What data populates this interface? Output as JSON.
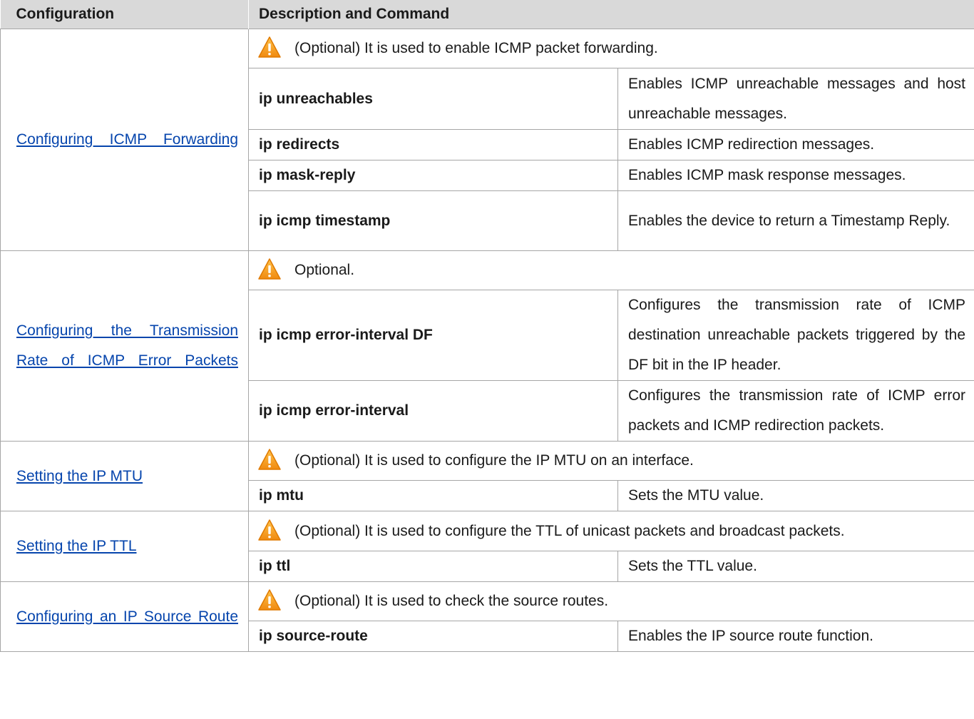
{
  "header": {
    "col1": "Configuration",
    "col2": "Description and Command"
  },
  "sections": [
    {
      "config_link": "Configuring ICMP Forwarding",
      "note": "(Optional) It is used to enable ICMP packet forwarding.",
      "rows": [
        {
          "command": "ip unreachables",
          "description": "Enables ICMP unreachable messages and host unreachable messages."
        },
        {
          "command": "ip redirects",
          "description": "Enables ICMP redirection messages."
        },
        {
          "command": "ip mask-reply",
          "description": "Enables ICMP mask response messages."
        },
        {
          "command": "ip icmp timestamp",
          "description": "Enables the device to return a Timestamp Reply."
        }
      ]
    },
    {
      "config_link": "Configuring the Transmission Rate of ICMP Error Packets",
      "note": "Optional.",
      "rows": [
        {
          "command": "ip icmp error-interval DF",
          "description": "Configures the transmission rate of ICMP destination unreachable packets triggered by the DF bit in the IP header."
        },
        {
          "command": "ip icmp error-interval",
          "description": "Configures the transmission rate of ICMP error packets and ICMP redirection packets."
        }
      ]
    },
    {
      "config_link": "Setting the IP MTU",
      "note": "(Optional) It is used to configure the IP MTU on an interface.",
      "rows": [
        {
          "command": "ip mtu",
          "description": "Sets the MTU value."
        }
      ]
    },
    {
      "config_link": "Setting the IP TTL",
      "note": "(Optional) It is used to configure the TTL of unicast packets and broadcast packets.",
      "rows": [
        {
          "command": "ip ttl",
          "description": "Sets the TTL value."
        }
      ]
    },
    {
      "config_link": "Configuring an IP Source Route",
      "note": "(Optional) It is used to check the source routes.",
      "rows": [
        {
          "command": "ip source-route",
          "description": "Enables the IP source route function."
        }
      ]
    }
  ],
  "icons": {
    "note_icon": "warning-triangle-icon"
  },
  "colors": {
    "header_bg": "#d9d9d9",
    "link": "#0645ad",
    "warning_orange": "#f0a020"
  }
}
